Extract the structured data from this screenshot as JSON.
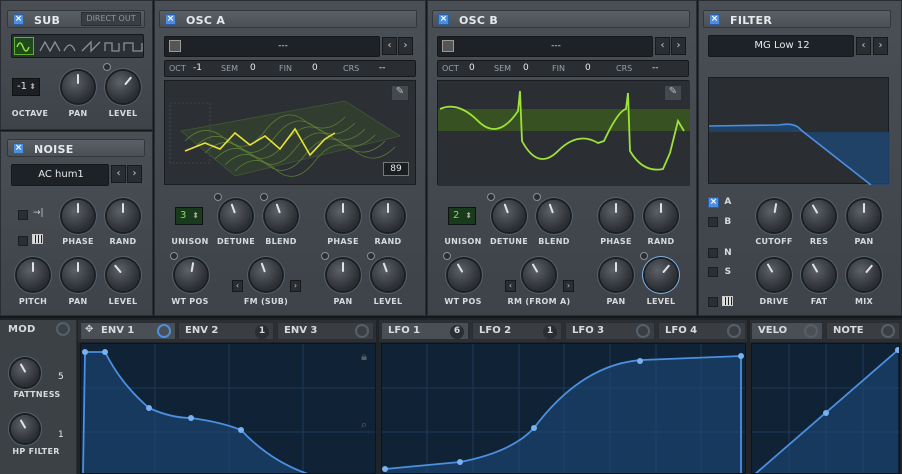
{
  "sub": {
    "title": "SUB",
    "direct_out": "DIRECT OUT",
    "octave_value": "-1",
    "labels": [
      "OCTAVE",
      "PAN",
      "LEVEL"
    ]
  },
  "noise": {
    "title": "NOISE",
    "preset": "AC hum1",
    "labels": [
      "PHASE",
      "RAND",
      "PITCH",
      "PAN",
      "LEVEL"
    ]
  },
  "osc_a": {
    "title": "OSC A",
    "wavetable": "---",
    "oct_label": "OCT",
    "oct": "-1",
    "sem_label": "SEM",
    "sem": "0",
    "fin_label": "FIN",
    "fin": "0",
    "crs_label": "CRS",
    "crs": "--",
    "frame": "89",
    "unison": "3",
    "labels": {
      "unison": "UNISON",
      "detune": "DETUNE",
      "blend": "BLEND",
      "phase": "PHASE",
      "rand": "RAND",
      "wtpos": "WT POS",
      "fm": "FM (SUB)",
      "pan": "PAN",
      "level": "LEVEL"
    }
  },
  "osc_b": {
    "title": "OSC B",
    "wavetable": "---",
    "oct_label": "OCT",
    "oct": "0",
    "sem_label": "SEM",
    "sem": "0",
    "fin_label": "FIN",
    "fin": "0",
    "crs_label": "CRS",
    "crs": "--",
    "unison": "2",
    "labels": {
      "unison": "UNISON",
      "detune": "DETUNE",
      "blend": "BLEND",
      "phase": "PHASE",
      "rand": "RAND",
      "wtpos": "WT POS",
      "rm": "RM (FROM A)",
      "pan": "PAN",
      "level": "LEVEL"
    }
  },
  "filter": {
    "title": "FILTER",
    "type": "MG Low 12",
    "route_a": "A",
    "route_b": "B",
    "route_n": "N",
    "route_s": "S",
    "labels": [
      "CUTOFF",
      "RES",
      "PAN",
      "DRIVE",
      "FAT",
      "MIX"
    ]
  },
  "mod": {
    "label": "MOD",
    "fattness": "FATTNESS",
    "fattness_count": "5",
    "hp_filter": "HP FILTER",
    "hp_count": "1"
  },
  "env_tabs": [
    {
      "label": "ENV 1",
      "count": ""
    },
    {
      "label": "ENV 2",
      "count": "1"
    },
    {
      "label": "ENV 3",
      "count": ""
    }
  ],
  "lfo_tabs": [
    {
      "label": "LFO 1",
      "count": "6"
    },
    {
      "label": "LFO 2",
      "count": "1"
    },
    {
      "label": "LFO 3",
      "count": ""
    },
    {
      "label": "LFO 4",
      "count": ""
    }
  ],
  "velo_tabs": [
    {
      "label": "VELO"
    },
    {
      "label": "NOTE"
    }
  ],
  "colors": {
    "accent": "#4c8fe0",
    "osc_green": "#9de23a",
    "wave_yellow": "#e8e23a",
    "graph_bg": "#0f2236"
  }
}
